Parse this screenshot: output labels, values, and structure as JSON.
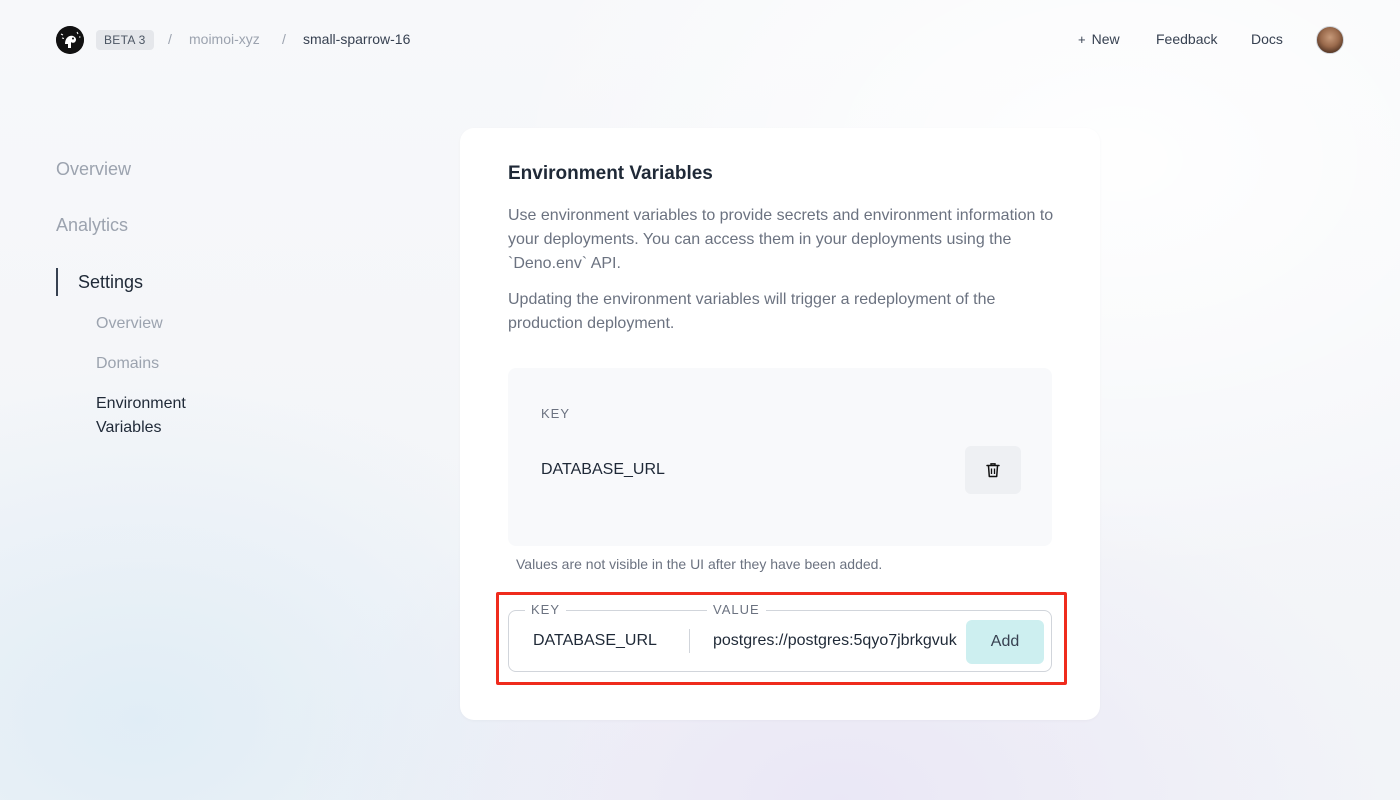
{
  "header": {
    "badge": "BETA 3",
    "separator": "/",
    "org": "moimoi-xyz",
    "project": "small-sparrow-16",
    "new_plus": "+",
    "new_label": "New",
    "feedback_label": "Feedback",
    "docs_label": "Docs"
  },
  "sidebar": {
    "items": [
      {
        "label": "Overview"
      },
      {
        "label": "Analytics"
      },
      {
        "label": "Settings"
      }
    ],
    "sub_items": [
      {
        "label": "Overview"
      },
      {
        "label": "Domains"
      },
      {
        "label": "Environment Variables"
      }
    ]
  },
  "card": {
    "title": "Environment Variables",
    "description": "Use environment variables to provide secrets and environment information to your deployments. You can access them in your deployments using the `Deno.env` API.",
    "description2": "Updating the environment variables will trigger a redeployment of the production deployment.",
    "existing": {
      "key_header": "KEY",
      "key": "DATABASE_URL"
    },
    "hint": "Values are not visible in the UI after they have been added.",
    "form": {
      "key_legend": "KEY",
      "value_legend": "VALUE",
      "key_value": "DATABASE_URL",
      "value_value": "postgres://postgres:5qyo7jbrkgvuk",
      "add_label": "Add"
    }
  },
  "colors": {
    "highlight": "#ef2b1d",
    "add_button": "#cdeff0"
  },
  "icons": {
    "logo": "deno-logo-icon",
    "delete": "trash-icon",
    "avatar": "user-avatar"
  }
}
